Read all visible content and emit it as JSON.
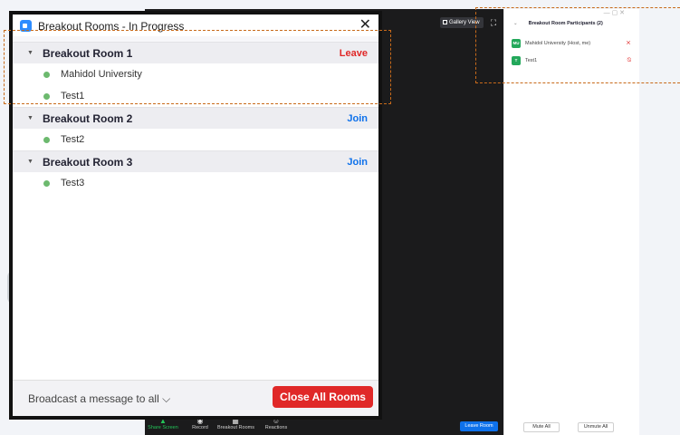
{
  "dialog": {
    "title": "Breakout Rooms - In Progress",
    "close_glyph": "✕",
    "rooms": [
      {
        "name": "Breakout Room 1",
        "action": "Leave",
        "members": [
          "Mahidol University",
          "Test1"
        ]
      },
      {
        "name": "Breakout Room 2",
        "action": "Join",
        "members": [
          "Test2"
        ]
      },
      {
        "name": "Breakout Room 3",
        "action": "Join",
        "members": [
          "Test3"
        ]
      }
    ],
    "broadcast_label": "Broadcast a message to all ⌵",
    "close_all_label": "Close All Rooms"
  },
  "meeting": {
    "gallery_view_label": "Gallery View",
    "toolbar": {
      "share_screen": "Share Screen",
      "record": "Record",
      "breakout_rooms": "Breakout Rooms",
      "reactions": "Reactions"
    },
    "leave_room_label": "Leave Room"
  },
  "participants": {
    "header": "Breakout Room Participants (2)",
    "rows": [
      {
        "avatar": "MU",
        "name": "Mahidol University (Host, me)",
        "status_icon": "muted-video-icon"
      },
      {
        "avatar": "T",
        "name": "Test1",
        "status_icon": "muted-mic-icon"
      }
    ],
    "mute_all_label": "Mute All",
    "unmute_all_label": "Unmute All"
  },
  "colors": {
    "accent_blue": "#0e71eb",
    "danger_red": "#e02828",
    "online_green": "#6cb96e",
    "avatar_green": "#23a85b"
  }
}
